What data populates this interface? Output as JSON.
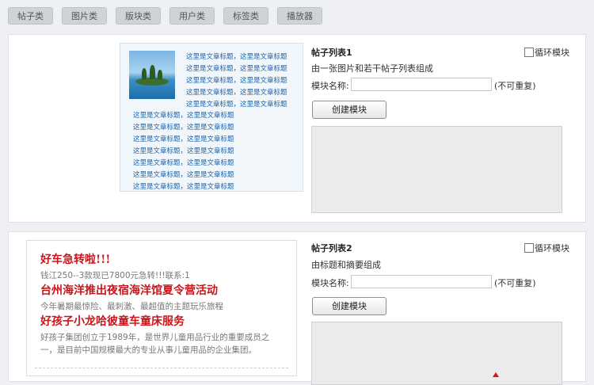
{
  "tabs": [
    "帖子类",
    "图片类",
    "版块类",
    "用户类",
    "标签类",
    "播放器"
  ],
  "module1": {
    "preview_links": [
      "这里是文章标题，这里是文章标题",
      "这里是文章标题，这里是文章标题",
      "这里是文章标题，这里是文章标题",
      "这里是文章标题，这里是文章标题",
      "这里是文章标题，这里是文章标题",
      "这里是文章标题，这里是文章标题",
      "这里是文章标题，这里是文章标题",
      "这里是文章标题，这里是文章标题",
      "这里是文章标题，这里是文章标题",
      "这里是文章标题，这里是文章标题",
      "这里是文章标题，这里是文章标题",
      "这里是文章标题，这里是文章标题",
      "这里是文章标题，这里是文章标题"
    ],
    "title": "帖子列表1",
    "loop_label": "循环模块",
    "description": "由一张图片和若干帖子列表组成",
    "name_label": "模块名称:",
    "name_value": "",
    "name_note": "(不可重复)",
    "create_button": "创建模块"
  },
  "module2": {
    "preview": {
      "headline1": "好车急转啦!!!",
      "sub1": "钱江250--3款现已7800元急转!!!联系:1",
      "headline2": "台州海洋推出夜宿海洋馆夏令营活动",
      "sub2": "今年暑期最惊险、最刺激、最超值的主题玩乐旅程",
      "headline3": "好孩子小龙哈彼童车童床服务",
      "sub3_line1": "好孩子集团创立于1989年，是世界儿童用品行业的重要成员之",
      "sub3_line2": "一，是目前中国规模最大的专业从事儿童用品的企业集团。"
    },
    "title": "帖子列表2",
    "loop_label": "循环模块",
    "description": "由标题和摘要组成",
    "name_label": "模块名称:",
    "name_value": "",
    "name_note": "(不可重复)",
    "create_button": "创建模块"
  }
}
